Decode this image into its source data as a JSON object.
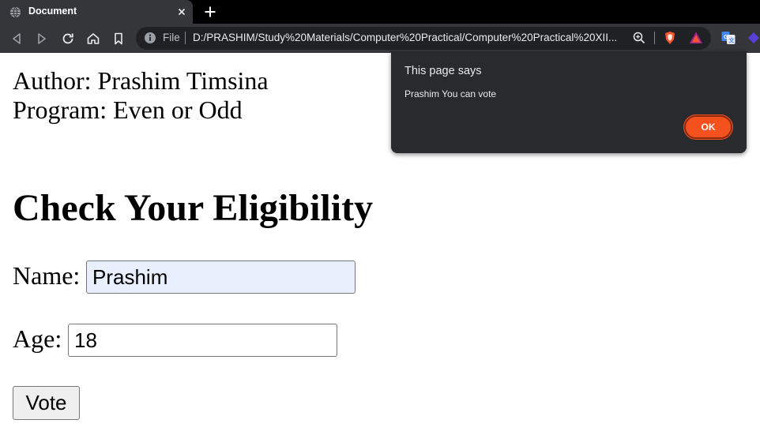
{
  "browser": {
    "tab": {
      "title": "Document",
      "icon": "globe-icon"
    },
    "address_bar": {
      "scheme_label": "File",
      "url": "D:/PRASHIM/Study%20Materials/Computer%20Practical/Computer%20Practical%20XII..."
    },
    "colors": {
      "frame": "#000000",
      "toolbar": "#35363a",
      "omnibox": "#202124"
    }
  },
  "page": {
    "author_line": "Author: Prashim Timsina",
    "program_line": "Program: Even or Odd",
    "heading": "Check Your Eligibility",
    "form": {
      "name_label": "Name:",
      "name_value": "Prashim",
      "age_label": "Age:",
      "age_value": "18",
      "vote_label": "Vote"
    }
  },
  "dialog": {
    "title": "This page says",
    "message": "Prashim You can vote",
    "ok_label": "OK",
    "colors": {
      "background": "#292a2d",
      "accent": "#f4511e"
    }
  }
}
